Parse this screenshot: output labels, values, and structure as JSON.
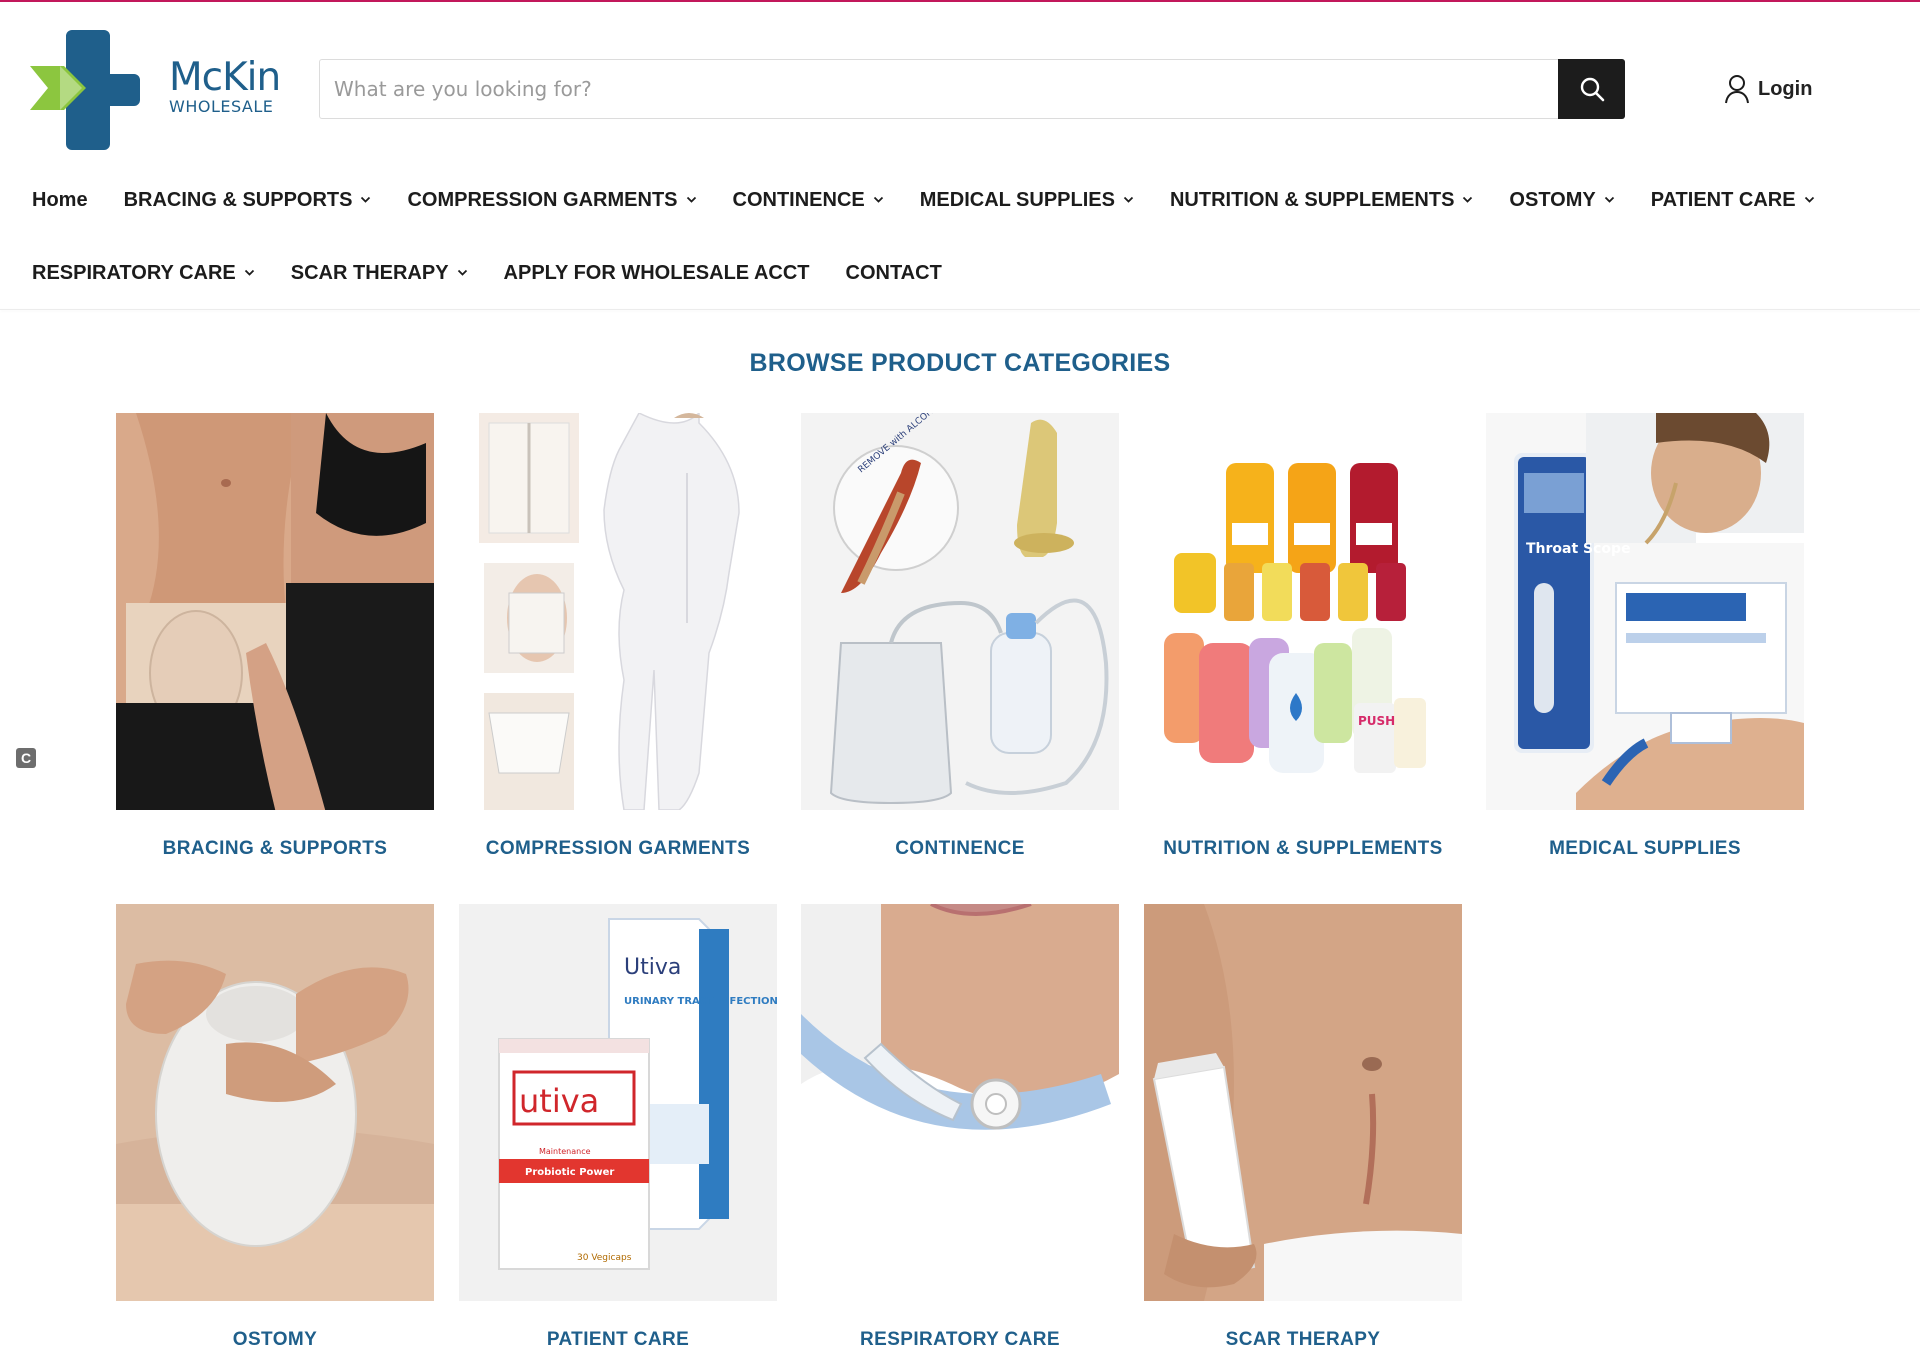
{
  "brand": {
    "name": "McKin",
    "sub": "WHOLESALE",
    "colors": {
      "primary": "#1f5f8b",
      "accent_green": "#8cc63f",
      "dark": "#1c1c1c",
      "top_line": "#c2185b"
    }
  },
  "search": {
    "placeholder": "What are you looking for?",
    "value": "",
    "icon": "search-icon"
  },
  "account": {
    "login_label": "Login",
    "icon": "user-icon"
  },
  "nav": {
    "row1": [
      {
        "label": "Home",
        "dropdown": false
      },
      {
        "label": "BRACING & SUPPORTS",
        "dropdown": true
      },
      {
        "label": "COMPRESSION GARMENTS",
        "dropdown": true
      },
      {
        "label": "CONTINENCE",
        "dropdown": true
      },
      {
        "label": "MEDICAL SUPPLIES",
        "dropdown": true
      },
      {
        "label": "NUTRITION & SUPPLEMENTS",
        "dropdown": true
      },
      {
        "label": "OSTOMY",
        "dropdown": true
      },
      {
        "label": "PATIENT CARE",
        "dropdown": true
      }
    ],
    "row2": [
      {
        "label": "RESPIRATORY CARE",
        "dropdown": true
      },
      {
        "label": "SCAR THERAPY",
        "dropdown": true
      },
      {
        "label": "APPLY FOR WHOLESALE ACCT",
        "dropdown": false
      },
      {
        "label": "CONTACT",
        "dropdown": false
      }
    ]
  },
  "side_badge": "C",
  "section": {
    "title": "BROWSE PRODUCT CATEGORIES",
    "categories": [
      {
        "label": "BRACING & SUPPORTS"
      },
      {
        "label": "COMPRESSION GARMENTS"
      },
      {
        "label": "CONTINENCE"
      },
      {
        "label": "NUTRITION & SUPPLEMENTS"
      },
      {
        "label": "MEDICAL SUPPLIES"
      },
      {
        "label": "OSTOMY"
      },
      {
        "label": "PATIENT CARE",
        "image_text": {
          "box_brand": "Utiva",
          "box_title": "URINARY TRACT INFECTION",
          "front_brand": "utiva",
          "front_line1": "Maintenance",
          "front_line2": "Probiotic Power",
          "front_count": "30 Vegicaps"
        }
      },
      {
        "label": "RESPIRATORY CARE"
      },
      {
        "label": "SCAR THERAPY"
      }
    ]
  },
  "image_text": {
    "throat_scope": "Throat Scope",
    "push": "PUSH",
    "remove_alcohol": "REMOVE with ALCOHOL"
  }
}
